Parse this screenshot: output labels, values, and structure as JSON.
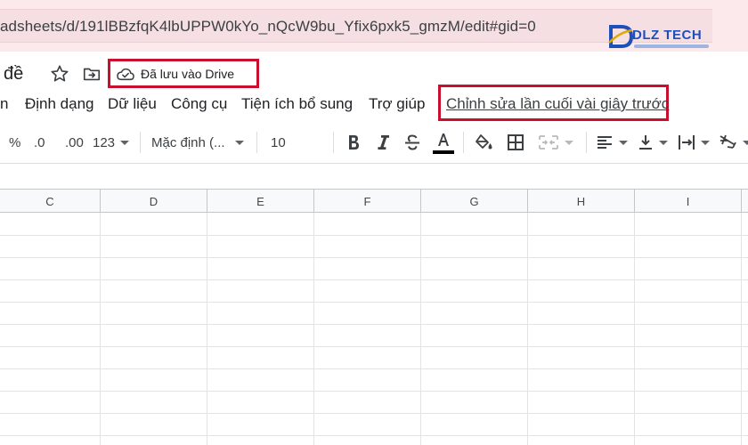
{
  "browser": {
    "url": "adsheets/d/191lBBzfqK4lbUPPW0kYo_nQcW9bu_Yfix6pxk5_gmzM/edit#gid=0"
  },
  "watermark": {
    "brand": "DLZ TECH",
    "brand_color": "#1f4fb8"
  },
  "header": {
    "title_fragment": "đề",
    "star_icon": "star-icon",
    "move_icon": "folder-move-icon",
    "save_status": "Đã lưu vào Drive",
    "save_status_icon": "cloud-check-icon",
    "highlight_color": "#c8102e"
  },
  "menu": {
    "items": [
      "n",
      "Định dạng",
      "Dữ liệu",
      "Công cụ",
      "Tiện ích bổ sung",
      "Trợ giúp"
    ],
    "last_edit": "Chỉnh sửa lần cuối vài giây trước"
  },
  "toolbar": {
    "percent": "%",
    "decrease_decimal": ".0",
    "increase_decimal": ".00",
    "more_formats": "123",
    "font_family": "Mặc định (...",
    "font_size": "10",
    "icons": [
      "bold-icon",
      "italic-icon",
      "strikethrough-icon",
      "text-color-icon",
      "fill-color-icon",
      "borders-icon",
      "merge-cells-icon",
      "horizontal-align-icon",
      "vertical-align-icon",
      "text-wrap-icon",
      "text-rotation-icon"
    ]
  },
  "sheet": {
    "columns": [
      "C",
      "D",
      "E",
      "F",
      "G",
      "H",
      "I"
    ]
  }
}
